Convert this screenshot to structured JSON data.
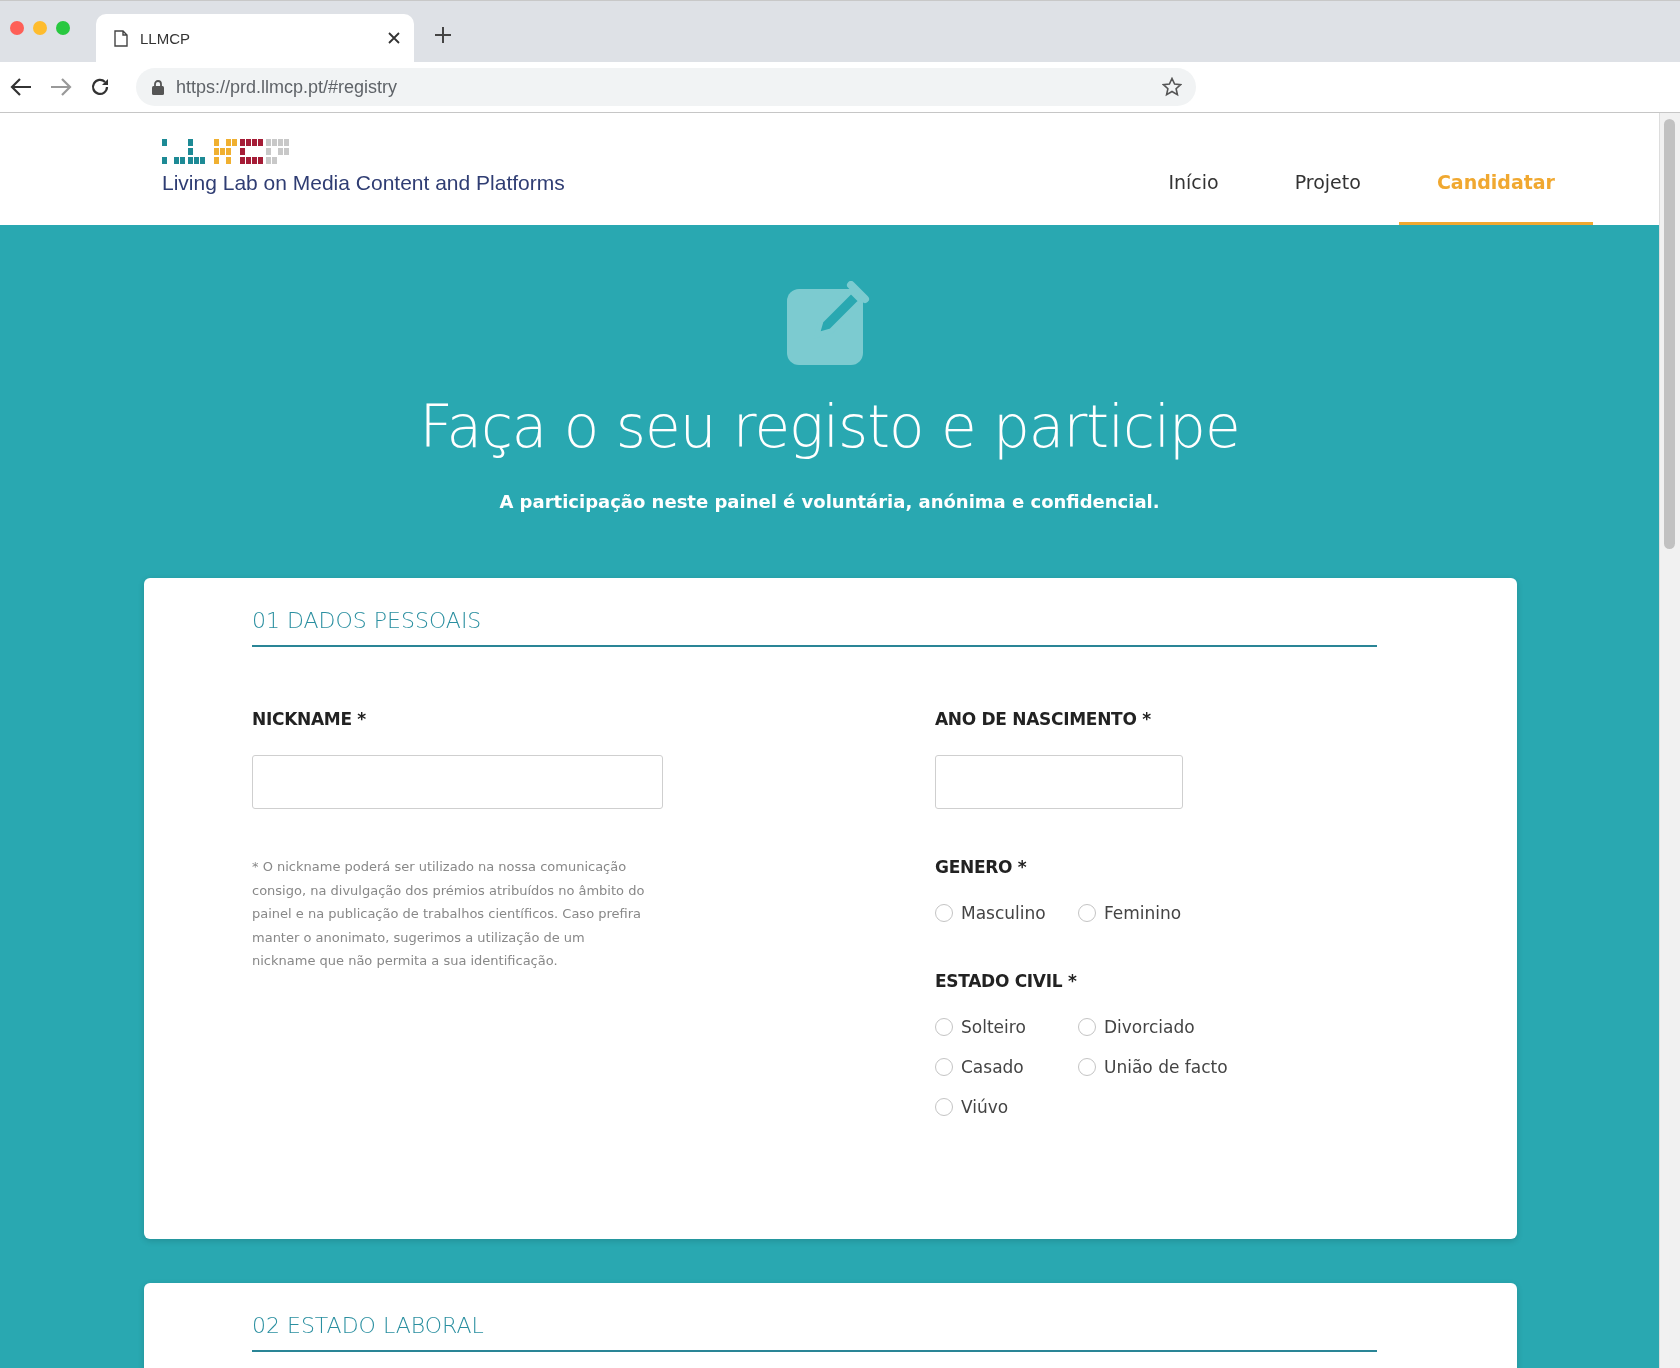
{
  "browser": {
    "tab_title": "LLMCP",
    "url": "https://prd.llmcp.pt/#registry"
  },
  "header": {
    "tagline": "Living Lab on Media Content and Platforms",
    "nav": [
      {
        "label": "Início",
        "selected": false
      },
      {
        "label": "Projeto",
        "selected": false
      },
      {
        "label": "Candidatar",
        "selected": true
      }
    ]
  },
  "hero": {
    "title": "Faça o seu registo e participe",
    "subtitle": "A participação neste painel é voluntária, anónima e confidencial."
  },
  "sections": [
    {
      "heading": "01 DADOS PESSOAIS",
      "nickname": {
        "label": "NICKNAME *",
        "note": "* O nickname poderá ser utilizado na nossa comunicação consigo, na divulgação dos prémios atribuídos no âmbito do painel e na publicação de trabalhos científicos. Caso prefira manter o anonimato, sugerimos a utilização de um nickname que não permita a sua identificação."
      },
      "birth_year": {
        "label": "ANO DE NASCIMENTO *"
      },
      "radio_groups": [
        {
          "label": "GENERO *",
          "options": [
            {
              "label": "Masculino",
              "selected": false
            },
            {
              "label": "Feminino",
              "selected": false
            }
          ]
        },
        {
          "label": "ESTADO CIVIL *",
          "options": [
            {
              "label": "Solteiro",
              "selected": false
            },
            {
              "label": "Divorciado",
              "selected": false
            },
            {
              "label": "Casado",
              "selected": false
            },
            {
              "label": "União de facto",
              "selected": false
            },
            {
              "label": "Viúvo",
              "selected": false
            }
          ]
        }
      ]
    },
    {
      "heading": "02 ESTADO LABORAL"
    }
  ]
}
